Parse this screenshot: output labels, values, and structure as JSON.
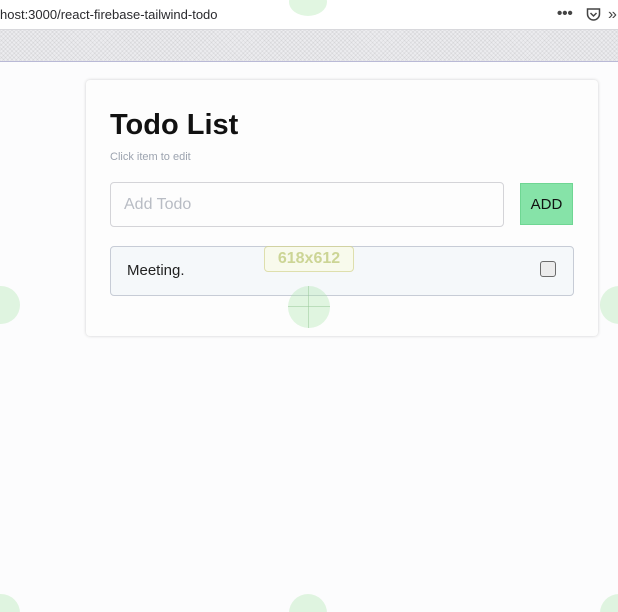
{
  "browser": {
    "url": "host:3000/react-firebase-tailwind-todo",
    "more_icon": "more-horizontal-icon",
    "pocket_icon": "pocket-icon",
    "overflow_icon": "overflow-menu-icon"
  },
  "app": {
    "title": "Todo List",
    "subtitle": "Click item to edit",
    "input": {
      "placeholder": "Add Todo",
      "value": ""
    },
    "add_label": "ADD",
    "todos": [
      {
        "text": "Meeting.",
        "completed": false
      }
    ]
  },
  "overlay": {
    "size_label": "618x612"
  },
  "colors": {
    "add_button": "#86e3a8",
    "todo_item_bg": "#f5f8fa",
    "subtitle": "#9ca3af"
  }
}
